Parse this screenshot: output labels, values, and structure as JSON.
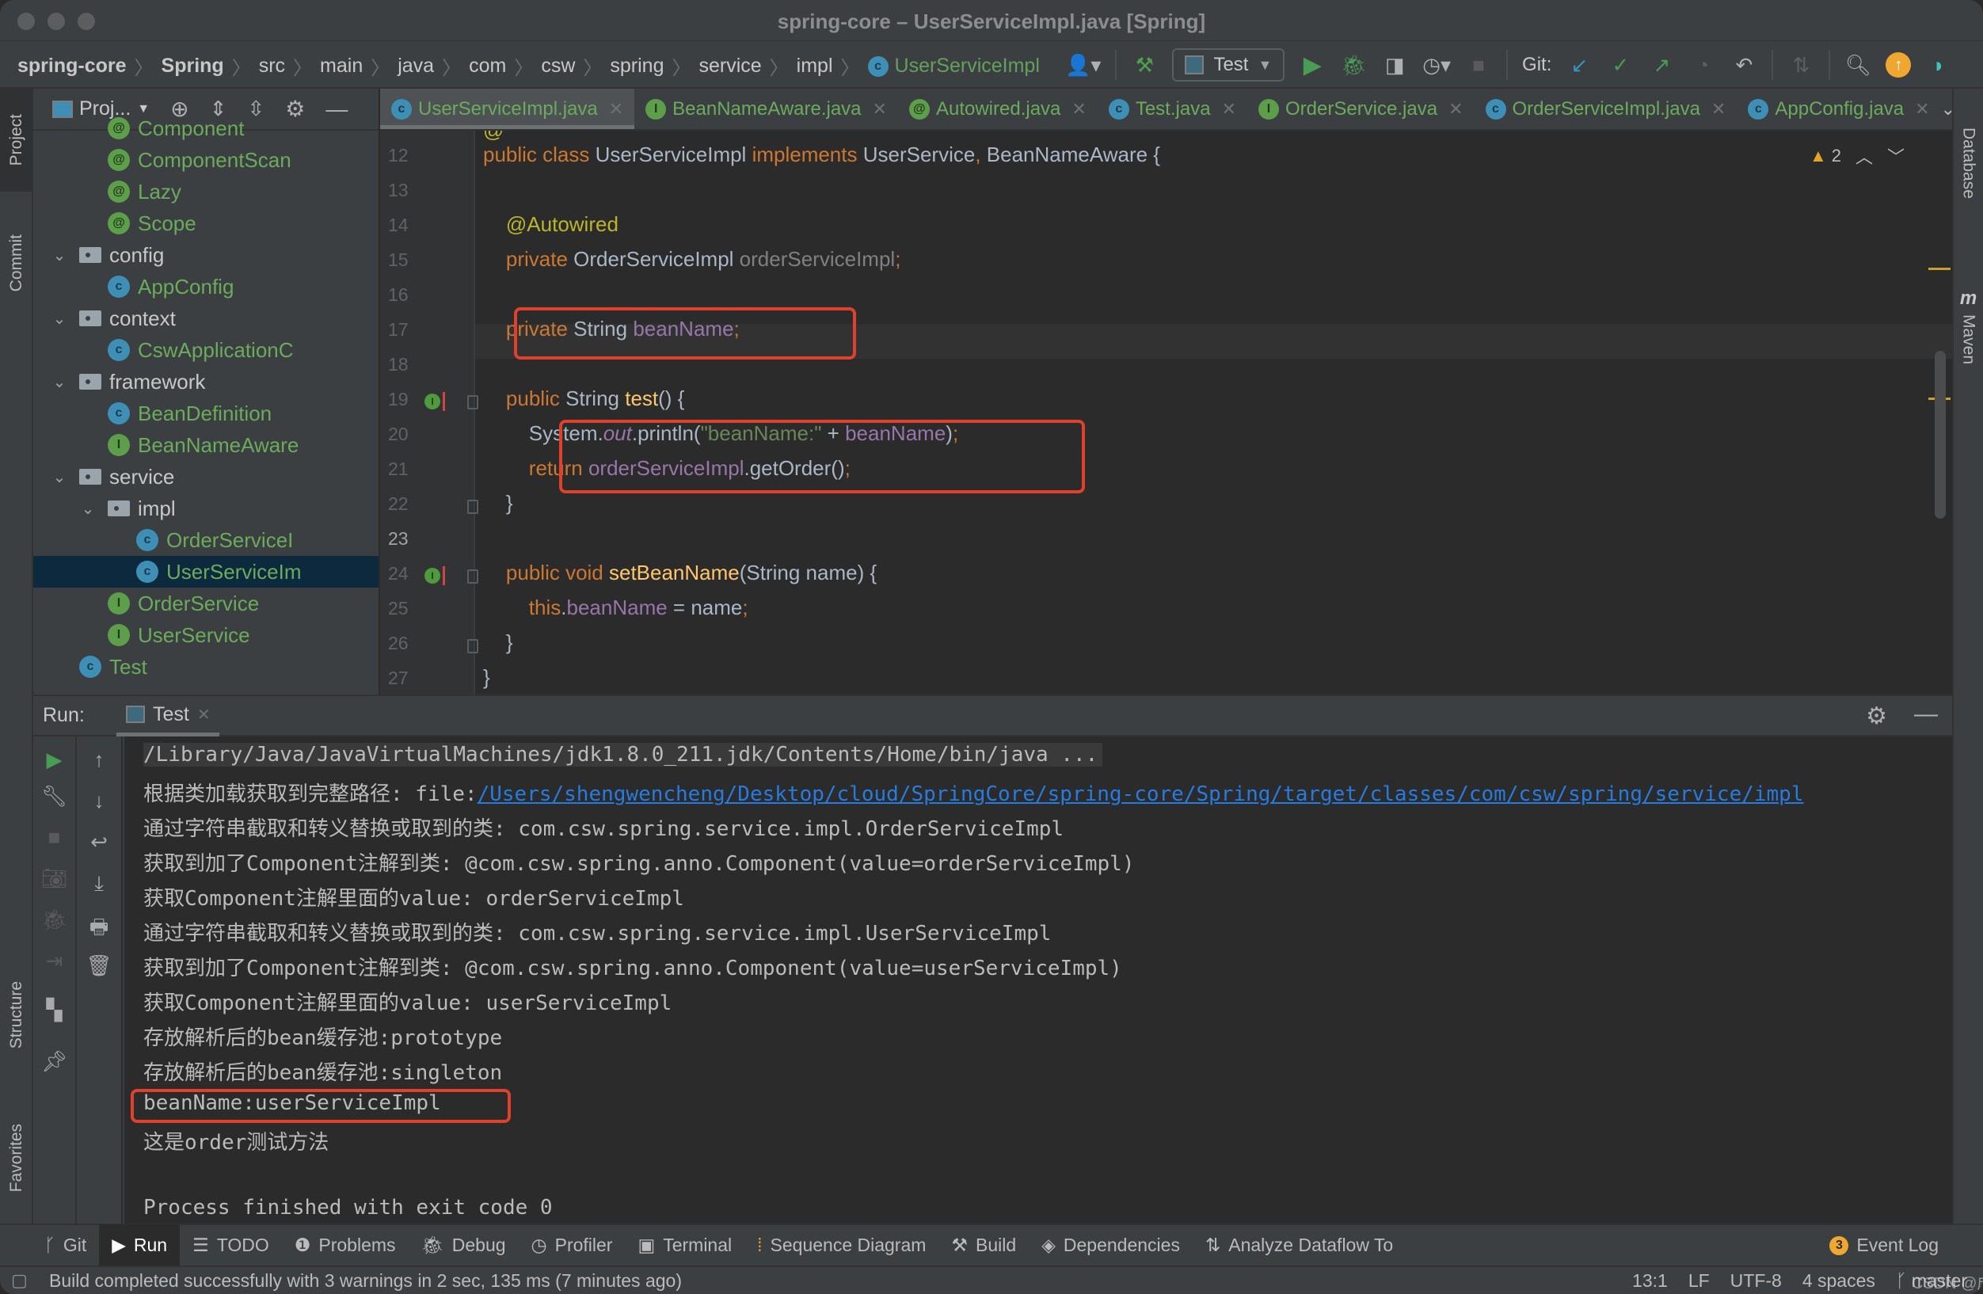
{
  "window": {
    "title": "spring-core – UserServiceImpl.java [Spring]"
  },
  "breadcrumb": [
    "spring-core",
    "Spring",
    "src",
    "main",
    "java",
    "com",
    "csw",
    "spring",
    "service",
    "impl",
    "UserServiceImpl"
  ],
  "toolbar": {
    "run_config": "Test",
    "git_label": "Git:"
  },
  "left_strip": {
    "project": "Project",
    "commit": "Commit",
    "structure": "Structure",
    "favorites": "Favorites"
  },
  "right_strip": {
    "database": "Database",
    "maven": "Maven"
  },
  "project_panel": {
    "view_label": "Proj...",
    "tree": [
      {
        "label": "Component",
        "kind": "annotation",
        "depth": 3,
        "clipped": true
      },
      {
        "label": "ComponentScan",
        "kind": "annotation",
        "depth": 3
      },
      {
        "label": "Lazy",
        "kind": "annotation",
        "depth": 3
      },
      {
        "label": "Scope",
        "kind": "annotation",
        "depth": 3
      },
      {
        "label": "config",
        "kind": "folder",
        "depth": 2,
        "expanded": true
      },
      {
        "label": "AppConfig",
        "kind": "class",
        "depth": 3
      },
      {
        "label": "context",
        "kind": "folder",
        "depth": 2,
        "expanded": true
      },
      {
        "label": "CswApplicationC",
        "kind": "class",
        "depth": 3
      },
      {
        "label": "framework",
        "kind": "folder",
        "depth": 2,
        "expanded": true
      },
      {
        "label": "BeanDefinition",
        "kind": "class",
        "depth": 3
      },
      {
        "label": "BeanNameAware",
        "kind": "interface",
        "depth": 3
      },
      {
        "label": "service",
        "kind": "folder",
        "depth": 2,
        "expanded": true
      },
      {
        "label": "impl",
        "kind": "folder",
        "depth": 3,
        "expanded": true
      },
      {
        "label": "OrderServiceI",
        "kind": "class",
        "depth": 4
      },
      {
        "label": "UserServiceIm",
        "kind": "class",
        "depth": 4,
        "selected": true
      },
      {
        "label": "OrderService",
        "kind": "interface",
        "depth": 3
      },
      {
        "label": "UserService",
        "kind": "interface",
        "depth": 3
      },
      {
        "label": "Test",
        "kind": "runnable-class",
        "depth": 2
      }
    ]
  },
  "editor_tabs": [
    {
      "label": "UserServiceImpl.java",
      "kind": "class",
      "active": true
    },
    {
      "label": "BeanNameAware.java",
      "kind": "interface"
    },
    {
      "label": "Autowired.java",
      "kind": "annotation"
    },
    {
      "label": "Test.java",
      "kind": "runnable-class"
    },
    {
      "label": "OrderService.java",
      "kind": "interface"
    },
    {
      "label": "OrderServiceImpl.java",
      "kind": "class"
    },
    {
      "label": "AppConfig.java",
      "kind": "class"
    }
  ],
  "editor": {
    "warning_count": "2",
    "current_line": 23,
    "lines": [
      {
        "n": "12",
        "tokens": [
          [
            "k",
            "public class "
          ],
          [
            "t",
            "UserServiceImpl "
          ],
          [
            "k",
            "implements "
          ],
          [
            "t",
            "UserService"
          ],
          [
            "k",
            ", "
          ],
          [
            "t",
            "BeanNameAware {"
          ]
        ]
      },
      {
        "n": "13",
        "tokens": []
      },
      {
        "n": "14",
        "tokens": [
          [
            "t",
            "    "
          ],
          [
            "an",
            "@Autowired"
          ]
        ]
      },
      {
        "n": "15",
        "tokens": [
          [
            "t",
            "    "
          ],
          [
            "k",
            "private "
          ],
          [
            "t",
            "OrderServiceImpl "
          ],
          [
            "g2",
            "orderServiceImpl"
          ],
          [
            "k",
            ";"
          ]
        ]
      },
      {
        "n": "16",
        "tokens": []
      },
      {
        "n": "17",
        "tokens": [
          [
            "t",
            "    "
          ],
          [
            "k",
            "private "
          ],
          [
            "t",
            "String "
          ],
          [
            "f",
            "beanName"
          ],
          [
            "k",
            ";"
          ]
        ]
      },
      {
        "n": "18",
        "tokens": []
      },
      {
        "n": "19",
        "tokens": [
          [
            "t",
            "    "
          ],
          [
            "k",
            "public "
          ],
          [
            "t",
            "String "
          ],
          [
            "m",
            "test"
          ],
          [
            "t",
            "() {"
          ]
        ]
      },
      {
        "n": "20",
        "tokens": [
          [
            "t",
            "        System."
          ],
          [
            "fi",
            "out"
          ],
          [
            "t",
            ".println("
          ],
          [
            "s",
            "\"beanName:\""
          ],
          [
            "t",
            " + "
          ],
          [
            "f",
            "beanName"
          ],
          [
            "t",
            ")"
          ],
          [
            "k",
            ";"
          ]
        ]
      },
      {
        "n": "21",
        "tokens": [
          [
            "t",
            "        "
          ],
          [
            "k",
            "return "
          ],
          [
            "f",
            "orderServiceImpl"
          ],
          [
            "t",
            ".getOrder()"
          ],
          [
            "k",
            ";"
          ]
        ]
      },
      {
        "n": "22",
        "tokens": [
          [
            "t",
            "    }"
          ]
        ]
      },
      {
        "n": "23",
        "tokens": []
      },
      {
        "n": "24",
        "tokens": [
          [
            "t",
            "    "
          ],
          [
            "k",
            "public void "
          ],
          [
            "m",
            "setBeanName"
          ],
          [
            "t",
            "(String name) {"
          ]
        ]
      },
      {
        "n": "25",
        "tokens": [
          [
            "t",
            "        "
          ],
          [
            "k",
            "this"
          ],
          [
            "t",
            "."
          ],
          [
            "f",
            "beanName"
          ],
          [
            "t",
            " = name"
          ],
          [
            "k",
            ";"
          ]
        ]
      },
      {
        "n": "26",
        "tokens": [
          [
            "t",
            "    }"
          ]
        ]
      },
      {
        "n": "27",
        "tokens": [
          [
            "t",
            "}"
          ]
        ]
      }
    ]
  },
  "run_panel": {
    "label": "Run:",
    "tab": "Test",
    "console": [
      {
        "text": "/Library/Java/JavaVirtualMachines/jdk1.8.0_211.jdk/Contents/Home/bin/java ...",
        "kind": "command"
      },
      {
        "prefix": "根据类加载获取到完整路径: file:",
        "link": "/Users/shengwencheng/Desktop/cloud/SpringCore/spring-core/Spring/target/classes/com/csw/spring/service/impl",
        "kind": "link"
      },
      {
        "text": "通过字符串截取和转义替换或取到的类: com.csw.spring.service.impl.OrderServiceImpl"
      },
      {
        "text": "获取到加了Component注解到类: @com.csw.spring.anno.Component(value=orderServiceImpl)"
      },
      {
        "text": "获取Component注解里面的value: orderServiceImpl"
      },
      {
        "text": "通过字符串截取和转义替换或取到的类: com.csw.spring.service.impl.UserServiceImpl"
      },
      {
        "text": "获取到加了Component注解到类: @com.csw.spring.anno.Component(value=userServiceImpl)"
      },
      {
        "text": "获取Component注解里面的value: userServiceImpl"
      },
      {
        "text": "存放解析后的bean缓存池:prototype"
      },
      {
        "text": "存放解析后的bean缓存池:singleton"
      },
      {
        "text": "beanName:userServiceImpl",
        "highlighted": true
      },
      {
        "text": "这是order测试方法"
      },
      {
        "text": ""
      },
      {
        "text": "Process finished with exit code 0"
      }
    ]
  },
  "tool_windows": [
    {
      "label": "Git",
      "icon": "git-branch-icon"
    },
    {
      "label": "Run",
      "icon": "run-icon",
      "active": true
    },
    {
      "label": "TODO",
      "icon": "list-icon"
    },
    {
      "label": "Problems",
      "icon": "problems-icon"
    },
    {
      "label": "Debug",
      "icon": "bug-icon"
    },
    {
      "label": "Profiler",
      "icon": "profiler-icon"
    },
    {
      "label": "Terminal",
      "icon": "terminal-icon"
    },
    {
      "label": "Sequence Diagram",
      "icon": "sequence-diagram-icon"
    },
    {
      "label": "Build",
      "icon": "hammer-icon"
    },
    {
      "label": "Dependencies",
      "icon": "dependencies-icon"
    },
    {
      "label": "Analyze Dataflow To",
      "icon": "dataflow-icon"
    }
  ],
  "event_log": {
    "label": "Event Log",
    "count": "3"
  },
  "status_bar": {
    "message": "Build completed successfully with 3 warnings in 2 sec, 135 ms (7 minutes ago)",
    "position": "13:1",
    "line_sep": "LF",
    "encoding": "UTF-8",
    "indent": "4 spaces",
    "branch": "master",
    "watermark": "CSDN @成胜文"
  },
  "colors": {
    "accent_green": "#499c54",
    "annotation_box": "#e0412b",
    "link": "#287bde",
    "selection": "#0d293e"
  }
}
